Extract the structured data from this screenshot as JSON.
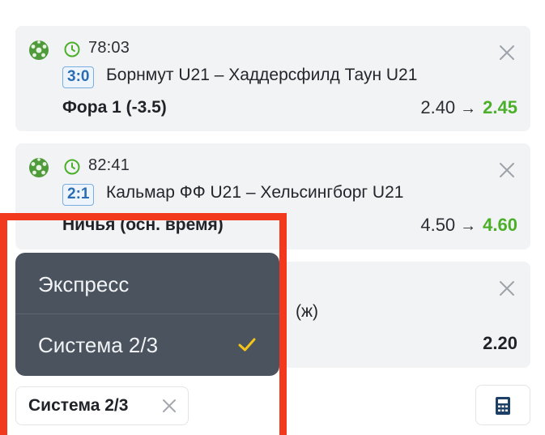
{
  "bets": [
    {
      "time": "78:03",
      "score": "3:0",
      "match": "Борнмут U21 – Хаддерсфилд Таун U21",
      "market": "Фора 1 (-3.5)",
      "old_odds": "2.40",
      "arrow": "→",
      "new_odds": "2.45"
    },
    {
      "time": "82:41",
      "score": "2:1",
      "match": "Кальмар ФФ U21 – Хельсингборг U21",
      "market": "Ничья (осн. время)",
      "old_odds": "4.50",
      "arrow": "→",
      "new_odds": "4.60"
    },
    {
      "match_visible": "(ж)",
      "odds": "2.20"
    }
  ],
  "bet_type_menu": {
    "options": [
      "Экспресс",
      "Система 2/3"
    ],
    "selected": "Система 2/3"
  },
  "bet_type_chip": {
    "label": "Система 2/3"
  },
  "colors": {
    "odds_up": "#4caf2a",
    "menu_bg": "#4a535e",
    "check": "#f5c518",
    "highlight": "#f2391e",
    "score_border": "#7aaee0"
  },
  "icons": {
    "sport": "football-icon",
    "timer": "clock-icon",
    "remove": "close-icon",
    "selected": "checkmark-icon",
    "calculator": "calculator-icon"
  }
}
